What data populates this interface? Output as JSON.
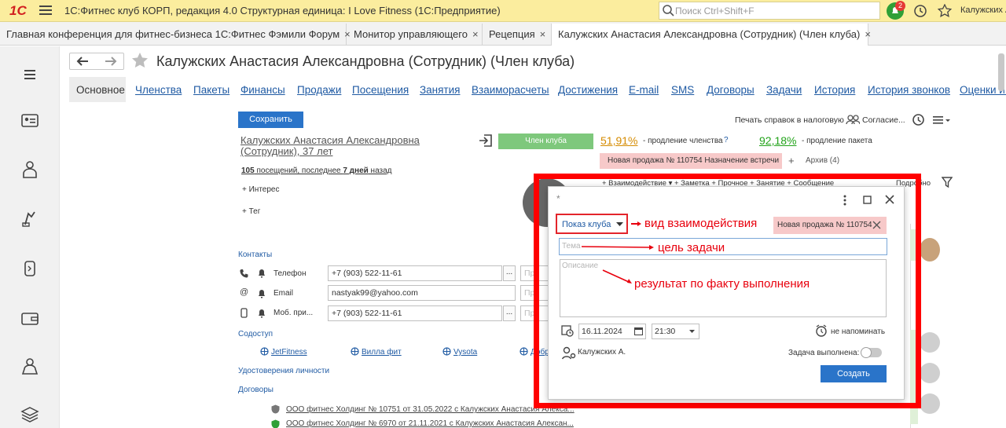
{
  "app": {
    "logo_text": "1С",
    "title": "1С:Фитнес клуб КОРП, редакция 4.0 Структурная единица: I Love Fitness  (1С:Предприятие)",
    "search_placeholder": "Поиск Ctrl+Shift+F",
    "notifications_count": "2",
    "user": "Калужских А..."
  },
  "tabs": [
    {
      "label": "Главная конференция для фитнес-бизнеса 1С:Фитнес Фэмили Форум",
      "close": "×"
    },
    {
      "label": "Монитор управляющего",
      "close": "×"
    },
    {
      "label": "Рецепция",
      "close": "×"
    },
    {
      "label": "Калужских Анастасия Александровна (Сотрудник) (Член клуба)",
      "close": "×"
    }
  ],
  "page": {
    "title": "Калужских Анастасия Александровна (Сотрудник) (Член клуба)",
    "sections": [
      "Основное",
      "Членства",
      "Пакеты",
      "Финансы",
      "Продажи",
      "Посещения",
      "Занятия",
      "Взаиморасчеты",
      "Достижения",
      "E-mail",
      "SMS",
      "Договоры",
      "Задачи",
      "История",
      "История звонков",
      "Оценки и о"
    ]
  },
  "form": {
    "save_button": "Сохранить",
    "print_link": "Печать справок в налоговую",
    "consent_link": "Согласие...",
    "client_name_line1": "Калужских Анастасия Александровна",
    "client_name_line2": "(Сотрудник), 37 лет",
    "visits_count": "105",
    "visits_text": " посещений, последнее ",
    "visits_days": "7 дней",
    "visits_suffix": " назад",
    "interest": "+ Интерес",
    "tag": "+ Тег",
    "member_badge": "Член клуба",
    "membership_percent": "51,91%",
    "membership_label": "- продление членства",
    "question": "?",
    "package_percent": "92,18%",
    "package_label": "- продление пакета",
    "new_sale_chip": "Новая продажа № 110754  Назначение встречи",
    "plus": "+",
    "archive": "Архив (4)",
    "toolbar_partial": "+ Взаимодействие ▾   + Заметка   + Прочное   + Занятие   + Сообщение",
    "more_partial": "Подробно",
    "contacts_header": "Контакты",
    "phone_label": "Телефон",
    "phone_value": "+7 (903) 522-11-61",
    "email_label": "Email",
    "email_value": "nastyak99@yahoo.com",
    "mobile_label": "Моб. при...",
    "mobile_value": "+7 (903) 522-11-61",
    "field_partial": "При",
    "cowork_header": "Содоступ",
    "cowork": [
      "JetFitness",
      "Вилла фит",
      "Vysota",
      "Добр"
    ],
    "id_header": "Удостоверения личности",
    "contracts_header": "Договоры",
    "contracts": [
      "ООО фитнес Холдинг № 10751 от 31.05.2022 с Калужских Анастасия Алекса...",
      "ООО фитнес Холдинг № 6970 от 21.11.2021 с Калужских Анастасия Алексан..."
    ]
  },
  "dialog": {
    "title": "*",
    "interaction_type": "Показ клуба",
    "new_sale_chip": "Новая продажа № 110754",
    "topic_placeholder": "Тема",
    "description_placeholder": "Описание",
    "date": "16.11.2024",
    "time": "21:30",
    "no_remind": "не напоминать",
    "assignee": "Калужских А.",
    "task_done_label": "Задача выполнена:",
    "create_button": "Создать"
  },
  "annotations": {
    "interaction_kind": "вид взаимодействия",
    "task_goal": "цель задачи",
    "result": "результат по факту выполнения"
  },
  "colors": {
    "topbar": "#fbed9e",
    "accent_blue": "#2a74c9",
    "link": "#1f5aa3",
    "green_badge": "#7ec87c",
    "pink_chip": "#f7c9c9",
    "annotation_red": "#ff0000",
    "orange_percent": "#d58b00",
    "green_percent": "#22a31a"
  }
}
